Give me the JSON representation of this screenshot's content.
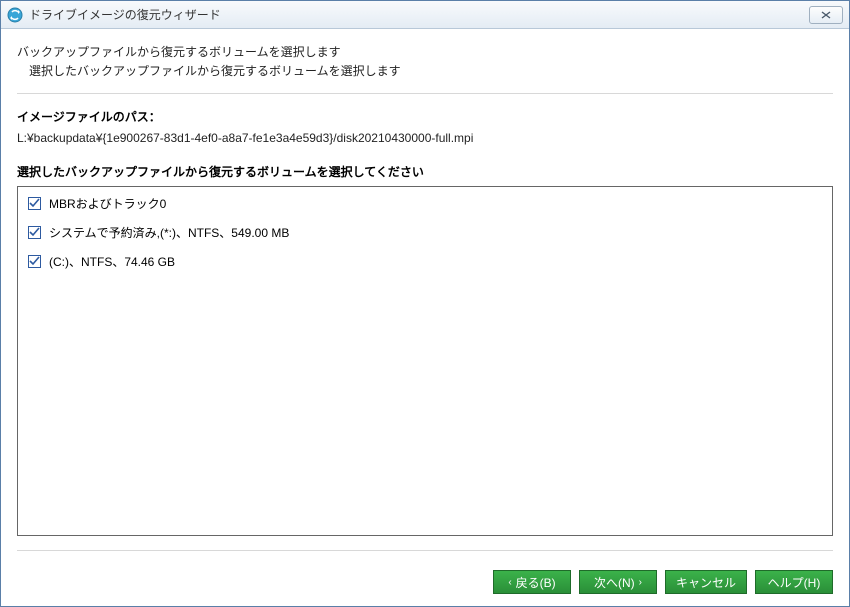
{
  "window": {
    "title": "ドライブイメージの復元ウィザード"
  },
  "header": {
    "title": "バックアップファイルから復元するボリュームを選択します",
    "subtitle": "選択したバックアップファイルから復元するボリュームを選択します"
  },
  "imagePath": {
    "label": "イメージファイルのパス：",
    "value": "L:¥backupdata¥{1e900267-83d1-4ef0-a8a7-fe1e3a4e59d3}/disk20210430000-full.mpi"
  },
  "volumes": {
    "label": "選択したバックアップファイルから復元するボリュームを選択してください",
    "items": [
      {
        "label": "MBRおよびトラック0",
        "checked": true
      },
      {
        "label": "システムで予約済み,(*:)、NTFS、549.00 MB",
        "checked": true
      },
      {
        "label": "(C:)、NTFS、74.46 GB",
        "checked": true
      }
    ]
  },
  "buttons": {
    "back": "戻る(B)",
    "next": "次へ(N)",
    "cancel": "キャンセル",
    "help": "ヘルプ(H)"
  }
}
